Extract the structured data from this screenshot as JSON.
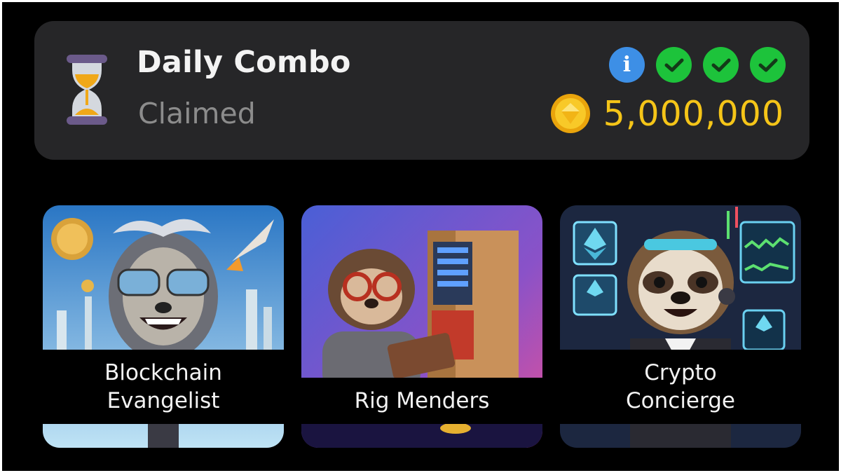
{
  "daily_combo": {
    "title": "Daily Combo",
    "status": "Claimed",
    "reward": "5,000,000",
    "info_glyph": "i",
    "icons": [
      "hourglass-icon",
      "info-icon",
      "check-icon",
      "check-icon",
      "check-icon",
      "gold-coin-icon"
    ],
    "colors": {
      "panel": "#262628",
      "info": "#3d8fe6",
      "check": "#1dc33b",
      "reward": "#f5c518"
    }
  },
  "cards": [
    {
      "label": "Blockchain\nEvangelist"
    },
    {
      "label": "Rig Menders"
    },
    {
      "label": "Crypto\nConcierge"
    }
  ]
}
